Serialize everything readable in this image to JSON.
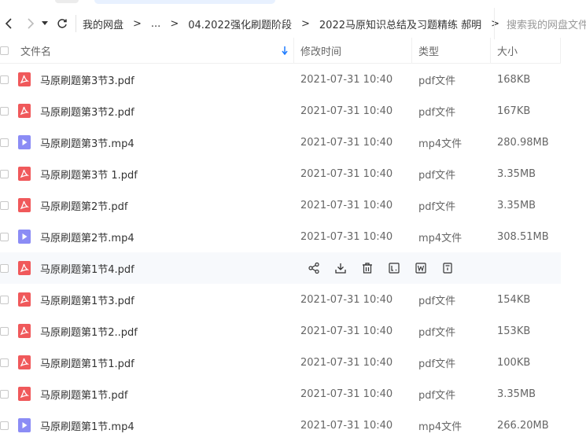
{
  "colors": {
    "pdf_icon": "#f0595b",
    "mp4_icon": "#8b8cf5",
    "accent": "#1f7cff"
  },
  "breadcrumb": {
    "root": "我的网盘",
    "ellipsis": "...",
    "folder1": "04.2022强化刷题阶段",
    "folder2": "2022马原知识总结及习题精练 郝明"
  },
  "search": {
    "placeholder": "搜索我的网盘文件"
  },
  "columns": {
    "name": "文件名",
    "modified": "修改时间",
    "type": "类型",
    "size": "大小"
  },
  "files": [
    {
      "name": "马原刷题第3节3.pdf",
      "icon": "pdf-icon",
      "modified": "2021-07-31 10:40",
      "type": "pdf文件",
      "size": "168KB"
    },
    {
      "name": "马原刷题第3节2.pdf",
      "icon": "pdf-icon",
      "modified": "2021-07-31 10:40",
      "type": "pdf文件",
      "size": "167KB"
    },
    {
      "name": "马原刷题第3节.mp4",
      "icon": "video-icon",
      "modified": "2021-07-31 10:40",
      "type": "mp4文件",
      "size": "280.98MB"
    },
    {
      "name": "马原刷题第3节 1.pdf",
      "icon": "pdf-icon",
      "modified": "2021-07-31 10:40",
      "type": "pdf文件",
      "size": "3.35MB"
    },
    {
      "name": "马原刷题第2节.pdf",
      "icon": "pdf-icon",
      "modified": "2021-07-31 10:40",
      "type": "pdf文件",
      "size": "3.35MB"
    },
    {
      "name": "马原刷题第2节.mp4",
      "icon": "video-icon",
      "modified": "2021-07-31 10:40",
      "type": "mp4文件",
      "size": "308.51MB"
    },
    {
      "name": "马原刷题第1节4.pdf",
      "icon": "pdf-icon",
      "hovered": true
    },
    {
      "name": "马原刷题第1节3.pdf",
      "icon": "pdf-icon",
      "modified": "2021-07-31 10:40",
      "type": "pdf文件",
      "size": "154KB"
    },
    {
      "name": "马原刷题第1节2..pdf",
      "icon": "pdf-icon",
      "modified": "2021-07-31 10:40",
      "type": "pdf文件",
      "size": "153KB"
    },
    {
      "name": "马原刷题第1节1.pdf",
      "icon": "pdf-icon",
      "modified": "2021-07-31 10:40",
      "type": "pdf文件",
      "size": "100KB"
    },
    {
      "name": "马原刷题第1节.pdf",
      "icon": "pdf-icon",
      "modified": "2021-07-31 10:40",
      "type": "pdf文件",
      "size": "3.35MB"
    },
    {
      "name": "马原刷题第1节.mp4",
      "icon": "video-icon",
      "modified": "2021-07-31 10:40",
      "type": "mp4文件",
      "size": "266.20MB"
    }
  ],
  "row_actions": [
    "share-icon",
    "download-icon",
    "delete-icon",
    "text-extract-icon",
    "word-convert-icon",
    "more-doc-icon"
  ]
}
